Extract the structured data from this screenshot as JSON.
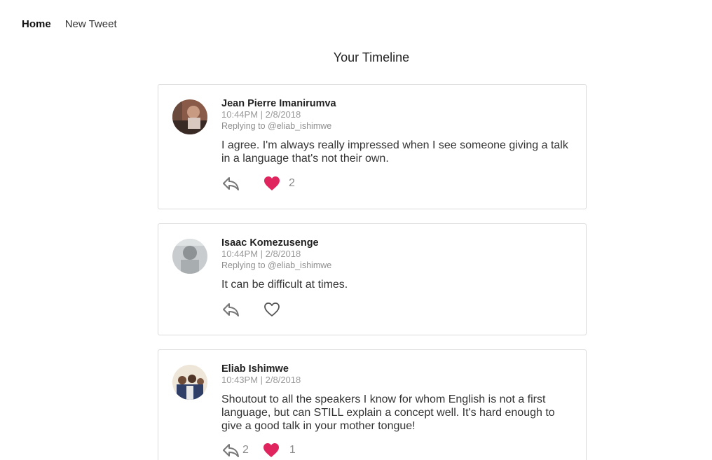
{
  "nav": {
    "home": "Home",
    "new_tweet": "New Tweet"
  },
  "page": {
    "title": "Your Timeline"
  },
  "tweets": [
    {
      "author": "Jean Pierre Imanirumva",
      "timestamp": "10:44PM | 2/8/2018",
      "replying_to": "Replying to @eliab_ishimwe",
      "text": "I agree. I'm always really impressed when I see someone giving a talk in a language that's not their own.",
      "reply_count": "",
      "liked": true,
      "like_count": "2"
    },
    {
      "author": "Isaac Komezusenge",
      "timestamp": "10:44PM | 2/8/2018",
      "replying_to": "Replying to @eliab_ishimwe",
      "text": "It can be difficult at times.",
      "reply_count": "",
      "liked": false,
      "like_count": ""
    },
    {
      "author": "Eliab Ishimwe",
      "timestamp": "10:43PM | 2/8/2018",
      "replying_to": "",
      "text": "Shoutout to all the speakers I know for whom English is not a first language, but can STILL explain a concept well. It's hard enough to give a good talk in your mother tongue!",
      "reply_count": "2",
      "liked": true,
      "like_count": "1"
    }
  ],
  "colors": {
    "like_active": "#e0245e",
    "icon_gray": "#777777",
    "meta_gray": "#9a9a9a",
    "border": "#dadada"
  },
  "icons": {
    "reply": "reply-arrow-icon",
    "like": "heart-icon"
  }
}
